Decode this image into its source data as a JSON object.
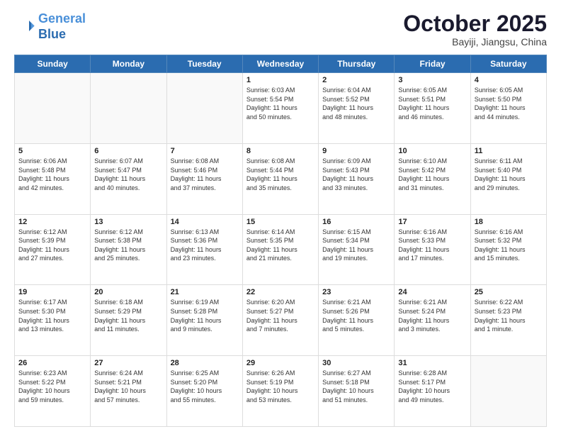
{
  "header": {
    "logo_line1": "General",
    "logo_line2": "Blue",
    "title": "October 2025",
    "location": "Bayiji, Jiangsu, China"
  },
  "days_of_week": [
    "Sunday",
    "Monday",
    "Tuesday",
    "Wednesday",
    "Thursday",
    "Friday",
    "Saturday"
  ],
  "weeks": [
    [
      {
        "day": "",
        "info": ""
      },
      {
        "day": "",
        "info": ""
      },
      {
        "day": "",
        "info": ""
      },
      {
        "day": "1",
        "info": "Sunrise: 6:03 AM\nSunset: 5:54 PM\nDaylight: 11 hours\nand 50 minutes."
      },
      {
        "day": "2",
        "info": "Sunrise: 6:04 AM\nSunset: 5:52 PM\nDaylight: 11 hours\nand 48 minutes."
      },
      {
        "day": "3",
        "info": "Sunrise: 6:05 AM\nSunset: 5:51 PM\nDaylight: 11 hours\nand 46 minutes."
      },
      {
        "day": "4",
        "info": "Sunrise: 6:05 AM\nSunset: 5:50 PM\nDaylight: 11 hours\nand 44 minutes."
      }
    ],
    [
      {
        "day": "5",
        "info": "Sunrise: 6:06 AM\nSunset: 5:48 PM\nDaylight: 11 hours\nand 42 minutes."
      },
      {
        "day": "6",
        "info": "Sunrise: 6:07 AM\nSunset: 5:47 PM\nDaylight: 11 hours\nand 40 minutes."
      },
      {
        "day": "7",
        "info": "Sunrise: 6:08 AM\nSunset: 5:46 PM\nDaylight: 11 hours\nand 37 minutes."
      },
      {
        "day": "8",
        "info": "Sunrise: 6:08 AM\nSunset: 5:44 PM\nDaylight: 11 hours\nand 35 minutes."
      },
      {
        "day": "9",
        "info": "Sunrise: 6:09 AM\nSunset: 5:43 PM\nDaylight: 11 hours\nand 33 minutes."
      },
      {
        "day": "10",
        "info": "Sunrise: 6:10 AM\nSunset: 5:42 PM\nDaylight: 11 hours\nand 31 minutes."
      },
      {
        "day": "11",
        "info": "Sunrise: 6:11 AM\nSunset: 5:40 PM\nDaylight: 11 hours\nand 29 minutes."
      }
    ],
    [
      {
        "day": "12",
        "info": "Sunrise: 6:12 AM\nSunset: 5:39 PM\nDaylight: 11 hours\nand 27 minutes."
      },
      {
        "day": "13",
        "info": "Sunrise: 6:12 AM\nSunset: 5:38 PM\nDaylight: 11 hours\nand 25 minutes."
      },
      {
        "day": "14",
        "info": "Sunrise: 6:13 AM\nSunset: 5:36 PM\nDaylight: 11 hours\nand 23 minutes."
      },
      {
        "day": "15",
        "info": "Sunrise: 6:14 AM\nSunset: 5:35 PM\nDaylight: 11 hours\nand 21 minutes."
      },
      {
        "day": "16",
        "info": "Sunrise: 6:15 AM\nSunset: 5:34 PM\nDaylight: 11 hours\nand 19 minutes."
      },
      {
        "day": "17",
        "info": "Sunrise: 6:16 AM\nSunset: 5:33 PM\nDaylight: 11 hours\nand 17 minutes."
      },
      {
        "day": "18",
        "info": "Sunrise: 6:16 AM\nSunset: 5:32 PM\nDaylight: 11 hours\nand 15 minutes."
      }
    ],
    [
      {
        "day": "19",
        "info": "Sunrise: 6:17 AM\nSunset: 5:30 PM\nDaylight: 11 hours\nand 13 minutes."
      },
      {
        "day": "20",
        "info": "Sunrise: 6:18 AM\nSunset: 5:29 PM\nDaylight: 11 hours\nand 11 minutes."
      },
      {
        "day": "21",
        "info": "Sunrise: 6:19 AM\nSunset: 5:28 PM\nDaylight: 11 hours\nand 9 minutes."
      },
      {
        "day": "22",
        "info": "Sunrise: 6:20 AM\nSunset: 5:27 PM\nDaylight: 11 hours\nand 7 minutes."
      },
      {
        "day": "23",
        "info": "Sunrise: 6:21 AM\nSunset: 5:26 PM\nDaylight: 11 hours\nand 5 minutes."
      },
      {
        "day": "24",
        "info": "Sunrise: 6:21 AM\nSunset: 5:24 PM\nDaylight: 11 hours\nand 3 minutes."
      },
      {
        "day": "25",
        "info": "Sunrise: 6:22 AM\nSunset: 5:23 PM\nDaylight: 11 hours\nand 1 minute."
      }
    ],
    [
      {
        "day": "26",
        "info": "Sunrise: 6:23 AM\nSunset: 5:22 PM\nDaylight: 10 hours\nand 59 minutes."
      },
      {
        "day": "27",
        "info": "Sunrise: 6:24 AM\nSunset: 5:21 PM\nDaylight: 10 hours\nand 57 minutes."
      },
      {
        "day": "28",
        "info": "Sunrise: 6:25 AM\nSunset: 5:20 PM\nDaylight: 10 hours\nand 55 minutes."
      },
      {
        "day": "29",
        "info": "Sunrise: 6:26 AM\nSunset: 5:19 PM\nDaylight: 10 hours\nand 53 minutes."
      },
      {
        "day": "30",
        "info": "Sunrise: 6:27 AM\nSunset: 5:18 PM\nDaylight: 10 hours\nand 51 minutes."
      },
      {
        "day": "31",
        "info": "Sunrise: 6:28 AM\nSunset: 5:17 PM\nDaylight: 10 hours\nand 49 minutes."
      },
      {
        "day": "",
        "info": ""
      }
    ]
  ]
}
